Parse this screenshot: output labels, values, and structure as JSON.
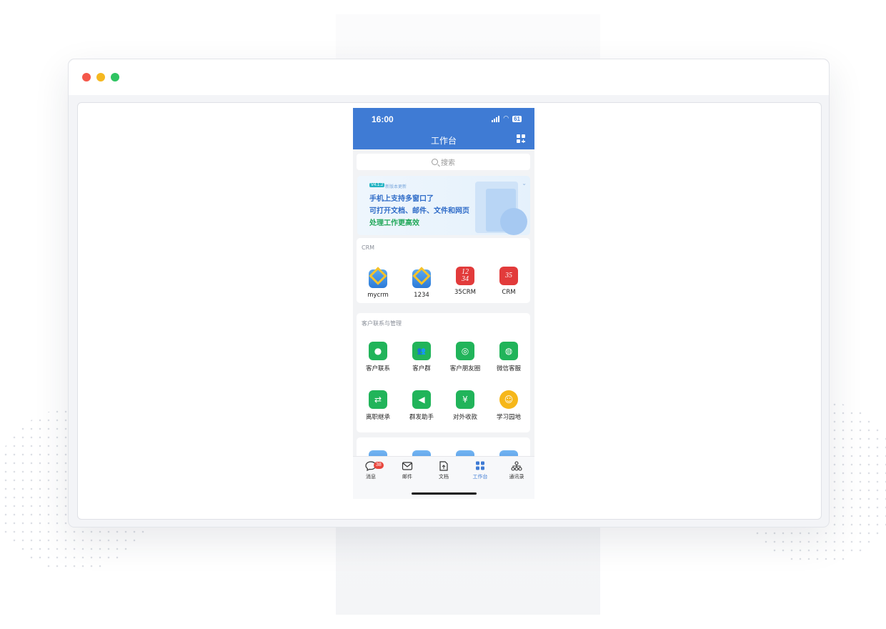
{
  "colors": {
    "header": "#3f7bd4",
    "accent_green": "#21b45a",
    "badge": "#e8463d"
  },
  "window": {
    "controls": [
      "close",
      "minimize",
      "zoom"
    ]
  },
  "status_bar": {
    "time": "16:00",
    "battery": "61"
  },
  "header": {
    "title": "工作台",
    "action_icon": "grid-add-icon"
  },
  "search": {
    "placeholder": "搜索"
  },
  "banner": {
    "tag": "V4.1.2",
    "tag_sub": "新版本更新",
    "lines": [
      "手机上支持多窗口了",
      "可打开文档、邮件、文件和网页",
      "处理工作更高效"
    ]
  },
  "sections": [
    {
      "title": "CRM",
      "apps": [
        {
          "label": "mycrm",
          "icon": "diamond-logo-icon"
        },
        {
          "label": "1234",
          "icon": "diamond-logo-icon"
        },
        {
          "label": "35CRM",
          "icon": "numbers-logo-icon",
          "glyph": "12\n34"
        },
        {
          "label": "CRM",
          "icon": "35-logo-icon",
          "glyph": "35"
        }
      ]
    },
    {
      "title": "客户联系与管理",
      "apps": [
        {
          "label": "客户联系",
          "icon": "chat-bubble-icon",
          "glyph": "●"
        },
        {
          "label": "客户群",
          "icon": "group-icon",
          "glyph": "👥"
        },
        {
          "label": "客户朋友圈",
          "icon": "moments-icon",
          "glyph": "◎"
        },
        {
          "label": "微信客服",
          "icon": "service-icon",
          "glyph": "◍"
        },
        {
          "label": "离职继承",
          "icon": "transfer-icon",
          "glyph": "⇄"
        },
        {
          "label": "群发助手",
          "icon": "megaphone-icon",
          "glyph": "◀"
        },
        {
          "label": "对外收款",
          "icon": "yuan-icon",
          "glyph": "¥"
        },
        {
          "label": "学习园地",
          "icon": "planet-icon",
          "glyph": "☺"
        }
      ]
    }
  ],
  "tabbar": [
    {
      "label": "消息",
      "icon": "message-icon",
      "badge": "38"
    },
    {
      "label": "邮件",
      "icon": "mail-icon"
    },
    {
      "label": "文档",
      "icon": "doc-icon"
    },
    {
      "label": "工作台",
      "icon": "workbench-icon",
      "active": true
    },
    {
      "label": "通讯录",
      "icon": "contacts-icon"
    }
  ]
}
